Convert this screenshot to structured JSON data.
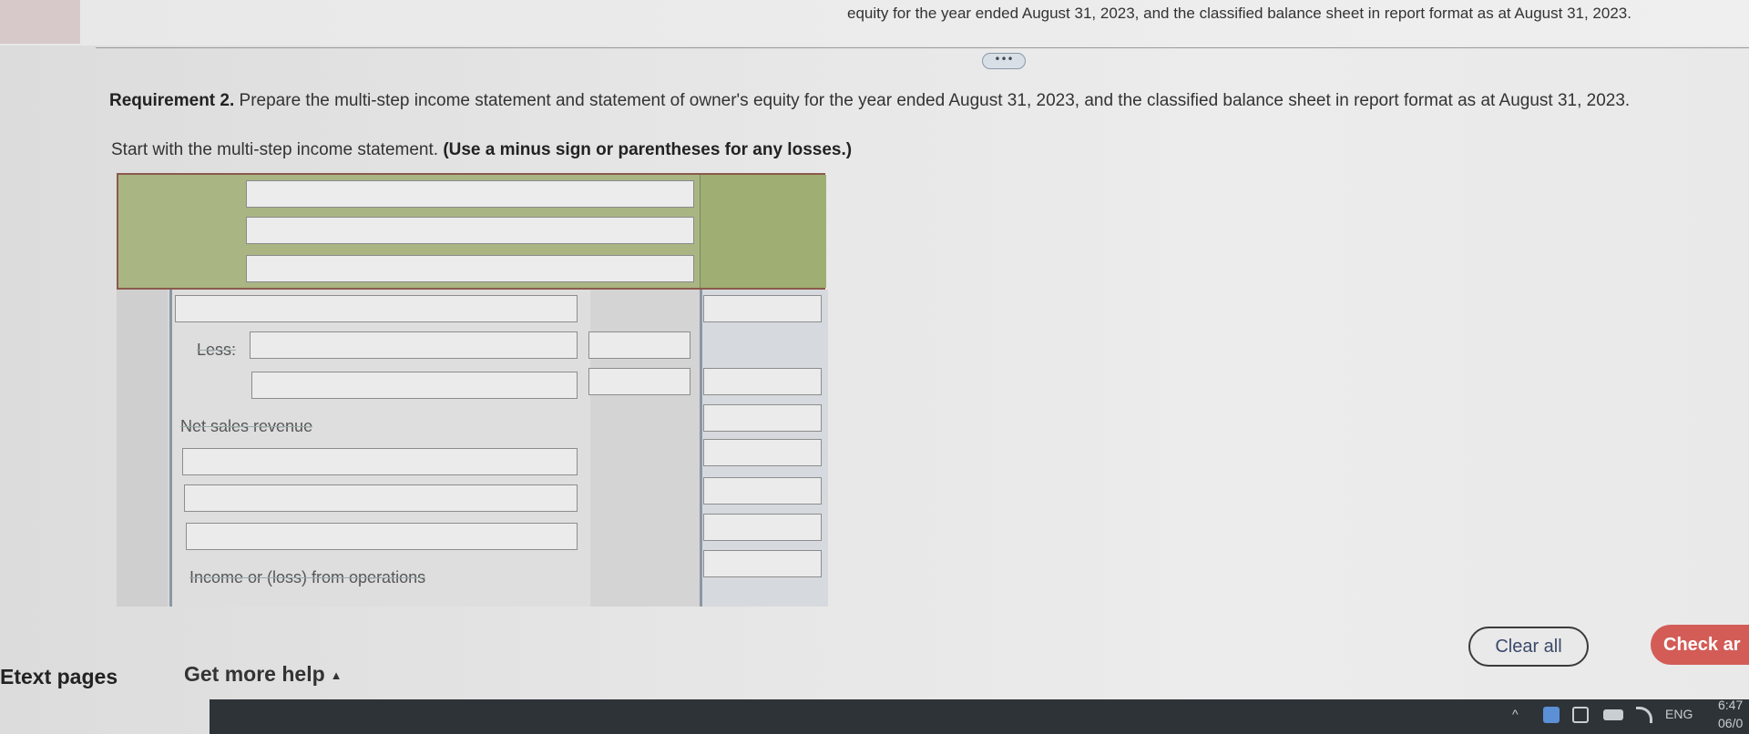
{
  "header": {
    "cut_text": "equity for the year ended August 31, 2023, and the classified balance sheet in report format as at August 31, 2023.",
    "more_label": "•••"
  },
  "requirement": {
    "label": "Requirement 2.",
    "text": " Prepare the multi-step income statement and statement of owner's equity for the year ended August 31, 2023, and the classified balance sheet in report format as at August 31, 2023."
  },
  "instruction": {
    "text": "Start with the multi-step income statement. ",
    "bold": "(Use a minus sign or parentheses for any losses.)"
  },
  "statement": {
    "header_inputs": [
      "",
      "",
      ""
    ],
    "labels": {
      "less": "Less:",
      "net_sales": "Net sales revenue",
      "income_ops": "Income or (loss) from operations"
    },
    "row_inputs": [
      "",
      "",
      "",
      "",
      "",
      "",
      "",
      "",
      "",
      "",
      "",
      "",
      "",
      "",
      "",
      ""
    ]
  },
  "actions": {
    "clear_all": "Clear all",
    "check_answer": "Check ar"
  },
  "footer": {
    "etext": "Etext pages",
    "help": "Get more help",
    "help_caret": "▲"
  },
  "taskbar": {
    "chevron": "^",
    "lang": "ENG",
    "time": "6:47",
    "date": "06/0"
  }
}
